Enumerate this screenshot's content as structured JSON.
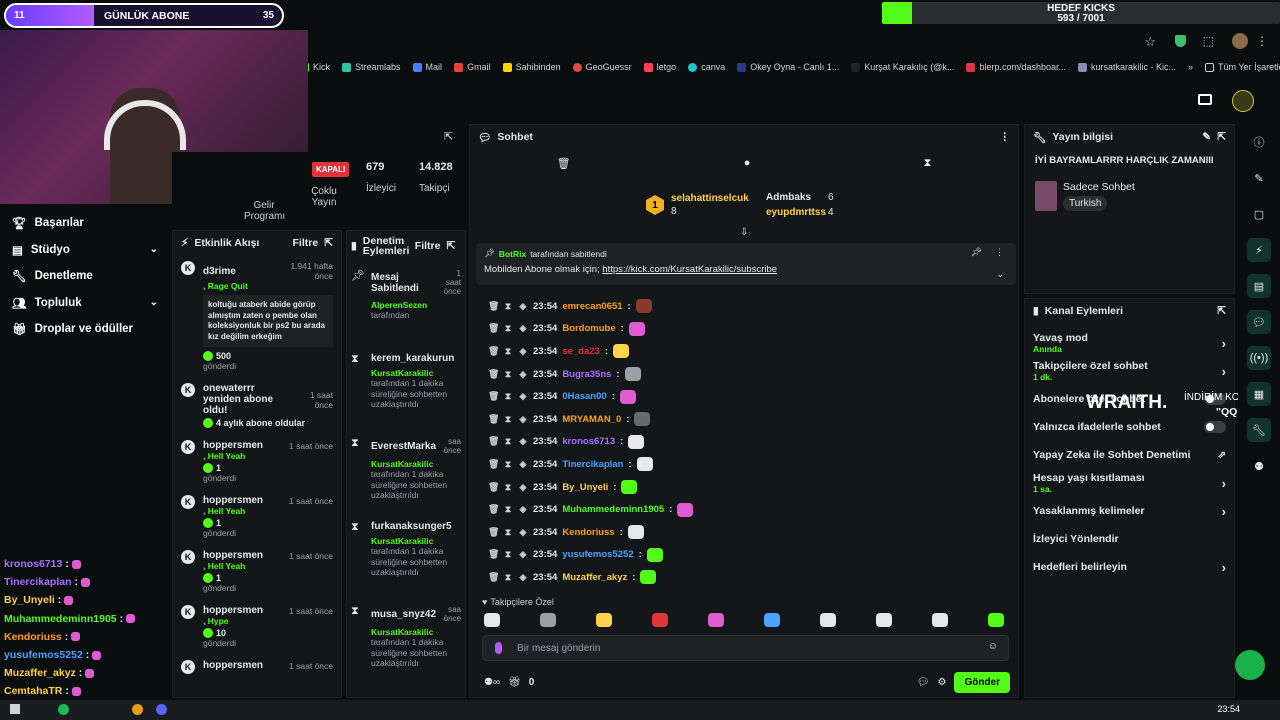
{
  "overlay": {
    "sub_count": "11",
    "sub_label": "GÜNLÜK ABONE",
    "sub_goal": "35",
    "kicks_label": "HEDEF KICKS",
    "kicks_value": "593 / 7001",
    "kicks_progress": 0.085,
    "wraith": "WRAITH.",
    "indirim": "İNDİRİM KODU:",
    "indirim_code": "\"QQ\""
  },
  "bookmarks": [
    "Kick",
    "Streamlabs",
    "Mail",
    "Gmail",
    "Sahibinden",
    "GeoGuessr",
    "letgo",
    "canva",
    "Okey Oyna - Canlı 1...",
    "Kurşat Karakılıç (@k...",
    "blerp.com/dashboar...",
    "kursatkarakilic - Kic...",
    "Tüm Yer İşaretleri"
  ],
  "stats": {
    "status": "KAPALI",
    "viewers": "679",
    "viewers_label": "İzleyici",
    "followers": "14.828",
    "followers_label": "Takipçi",
    "col1": "Çoklu Yayın",
    "col0": "Gelir Programı"
  },
  "nav": [
    {
      "label": "Başarılar",
      "chev": false
    },
    {
      "label": "Stüdyo",
      "chev": true
    },
    {
      "label": "Denetleme",
      "chev": false
    },
    {
      "label": "Topluluk",
      "chev": true
    },
    {
      "label": "Droplar ve ödüller",
      "chev": false
    }
  ],
  "left_chat": [
    {
      "user": "kronos6713",
      "color": "#a970ff"
    },
    {
      "user": "Tinercikaplan",
      "color": "#a970ff"
    },
    {
      "user": "By_Unyeli",
      "color": "#ffd24a"
    },
    {
      "user": "Muhammedeminn1905",
      "color": "#53fc18"
    },
    {
      "user": "Kendoriuss",
      "color": "#ff9f1a"
    },
    {
      "user": "yusufemos5252",
      "color": "#4aa3ff"
    },
    {
      "user": "Muzaffer_akyz",
      "color": "#ffd24a"
    },
    {
      "user": "CemtahaTR",
      "color": "#ffd24a"
    }
  ],
  "activity": {
    "title": "Etkinlik Akışı",
    "filter": "Filtre",
    "items": [
      {
        "user": "d3rime",
        "time": "1.941 hafta önce",
        "reward": "Rage Quit",
        "message": "koltuğu ataberk abide görüp almıştım zaten o pembe olan koleksiyonluk bir ps2 bu arada kız değilim erkeğim",
        "amount": "500",
        "sent": "gönderdi"
      },
      {
        "user": "onewaterrr yeniden abone oldu!",
        "time": "1 saat önce",
        "reward": "",
        "message": "",
        "amount": "4 aylık abone oldular",
        "sent": ""
      },
      {
        "user": "hoppersmen",
        "time": "1 saat önce",
        "reward": "Hell Yeah",
        "message": "",
        "amount": "1",
        "sent": "gönderdi"
      },
      {
        "user": "hoppersmen",
        "time": "1 saat önce",
        "reward": "Hell Yeah",
        "message": "",
        "amount": "1",
        "sent": "gönderdi"
      },
      {
        "user": "hoppersmen",
        "time": "1 saat önce",
        "reward": "Hell Yeah",
        "message": "",
        "amount": "1",
        "sent": "gönderdi"
      },
      {
        "user": "hoppersmen",
        "time": "1 saat önce",
        "reward": "Hype",
        "message": "",
        "amount": "10",
        "sent": "gönderdi"
      },
      {
        "user": "hoppersmen",
        "time": "1 saat önce",
        "reward": "",
        "message": "",
        "amount": "",
        "sent": ""
      }
    ]
  },
  "mod": {
    "title": "Denetim Eylemleri",
    "filter": "Filtre",
    "items": [
      {
        "user": "Mesaj Sabitlendi",
        "time": "1 saat önce",
        "by": "AlperenSezen",
        "desc": "tarafından"
      },
      {
        "user": "kerem_karakurun",
        "time": "",
        "by": "KursatKarakilic",
        "desc": "tarafından 1 dakika süreliğine sohbetten uzaklaştırıldı"
      },
      {
        "user": "EverestMarka",
        "time": "saa önce",
        "by": "KursatKarakilic",
        "desc": "tarafından 1 dakika süreliğine sohbetten uzaklaştırıldı"
      },
      {
        "user": "furkanaksunger5",
        "time": "",
        "by": "KursatKarakilic",
        "desc": "tarafından 1 dakika süreliğine sohbetten uzaklaştırıldı"
      },
      {
        "user": "musa_snyz42",
        "time": "saa önce",
        "by": "KursatKarakilic",
        "desc": "tarafından 1 dakika süreliğine sohbetten uzaklaştırıldı"
      }
    ]
  },
  "chat": {
    "title": "Sohbet",
    "leaders": [
      {
        "user": "selahattinselcuk",
        "count": "8"
      },
      {
        "user": "Admbaks",
        "count": "6"
      },
      {
        "user": "eyupdmrttss",
        "count": "4"
      }
    ],
    "pinned_by": "BotRix",
    "pinned_suffix": "tarafından sabitlendi",
    "pinned_text": "Mobilden Abone olmak için;",
    "pinned_link": "https://kick.com/KursatKarakilic/subscribe",
    "messages": [
      {
        "time": "23:54",
        "user": "emrecan0651",
        "color": "#ff9f1a",
        "emote": "#8a3a2a"
      },
      {
        "time": "23:54",
        "user": "Bordomube",
        "color": "#ff9f1a",
        "emote": "#e05ad0"
      },
      {
        "time": "23:54",
        "user": "se_da23",
        "color": "#e0343a",
        "emote": "#ffd24a"
      },
      {
        "time": "23:54",
        "user": "Bugra35ns",
        "color": "#a970ff",
        "emote": "#9aa0a6"
      },
      {
        "time": "23:54",
        "user": "0Hasan00",
        "color": "#4aa3ff",
        "emote": "#e05ad0"
      },
      {
        "time": "23:54",
        "user": "MRYAMAN_0",
        "color": "#ff9f1a",
        "emote": "#6a6a6a"
      },
      {
        "time": "23:54",
        "user": "kronos6713",
        "color": "#a970ff",
        "emote": "#e8e8e8"
      },
      {
        "time": "23:54",
        "user": "Tinercikaplan",
        "color": "#4aa3ff",
        "emote": "#e8e8e8"
      },
      {
        "time": "23:54",
        "user": "By_Unyeli",
        "color": "#ffd24a",
        "emote": "#53fc18"
      },
      {
        "time": "23:54",
        "user": "Muhammedeminn1905",
        "color": "#53fc18",
        "emote": "#e05ad0"
      },
      {
        "time": "23:54",
        "user": "Kendoriuss",
        "color": "#ff9f1a",
        "emote": "#e8e8e8"
      },
      {
        "time": "23:54",
        "user": "yusufemos5252",
        "color": "#4aa3ff",
        "emote": "#53fc18"
      },
      {
        "time": "23:54",
        "user": "Muzaffer_akyz",
        "color": "#ffd24a",
        "emote": "#53fc18"
      }
    ],
    "followers_only": "Takipçilere Özel",
    "placeholder": "Bir mesaj gönderin",
    "send": "Gönder",
    "points": "0"
  },
  "info": {
    "title": "Yayın bilgisi",
    "stream_title": "İYİ BAYRAMLARRR HARÇLIK ZAMANIII",
    "category": "Sadece Sohbet",
    "language": "Turkish"
  },
  "actions": {
    "title": "Kanal Eylemleri",
    "items": [
      {
        "label": "Yavaş mod",
        "sub": "Anında",
        "ctrl": "chev"
      },
      {
        "label": "Takipçilere özel sohbet",
        "sub": "1 dk.",
        "ctrl": "chev"
      },
      {
        "label": "Abonelere özel sohbet",
        "sub": "",
        "ctrl": "toggle"
      },
      {
        "label": "Yalnızca ifadelerle sohbet",
        "sub": "",
        "ctrl": "toggle"
      },
      {
        "label": "Yapay Zeka ile Sohbet Denetimi",
        "sub": "",
        "ctrl": "ext"
      },
      {
        "label": "Hesap yaşı kısıtlaması",
        "sub": "1 sa.",
        "ctrl": "chev"
      },
      {
        "label": "Yasaklanmış kelimeler",
        "sub": "",
        "ctrl": "chev"
      },
      {
        "label": "İzleyici Yönlendir",
        "sub": "",
        "ctrl": ""
      },
      {
        "label": "Hedefleri belirleyin",
        "sub": "",
        "ctrl": "chev"
      }
    ]
  },
  "taskbar": {
    "time": "23:54"
  }
}
